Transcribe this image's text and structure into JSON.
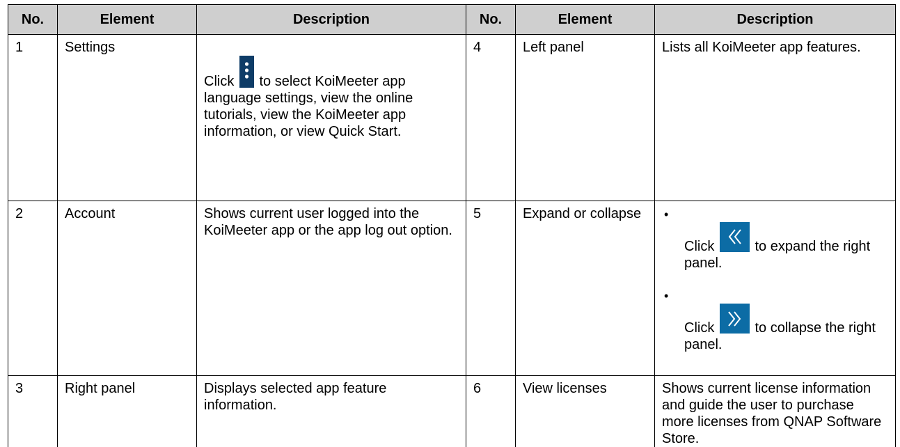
{
  "headers": [
    "No.",
    "Element",
    "Description",
    "No.",
    "Element",
    "Description"
  ],
  "rows": [
    {
      "no_left": "1",
      "element_left": "Settings",
      "desc_left_pre": "Click",
      "desc_left_icon": "more-vertical-icon",
      "desc_left_post": "to select KoiMeeter app language settings, view the online tutorials, view the KoiMeeter app information, or view Quick Start.",
      "no_right": "4",
      "element_right": "Left panel",
      "desc_right": "Lists all KoiMeeter app features."
    },
    {
      "no_left": "2",
      "element_left": "Account",
      "desc_left": "Shows current user logged into the KoiMeeter app or the app log out option.",
      "no_right": "5",
      "element_right": "Expand or collapse",
      "bullets": [
        {
          "bullet": "•",
          "pre": "Click",
          "icon": "double-chevron-left-icon",
          "post": "to expand the right panel."
        },
        {
          "bullet": "•",
          "pre": "Click",
          "icon": "double-chevron-right-icon",
          "post": "to collapse the right panel."
        }
      ]
    },
    {
      "no_left": "3",
      "element_left": "Right panel",
      "desc_left": "Displays selected app feature information.",
      "no_right": "6",
      "element_right": "View licenses",
      "desc_right": "Shows current license information and guide the user to purchase more licenses from QNAP Software Store."
    }
  ],
  "colors": {
    "header_bg": "#cfcfcf",
    "icon_dark": "#0e3c67",
    "icon_blue": "#0c6ca5"
  }
}
